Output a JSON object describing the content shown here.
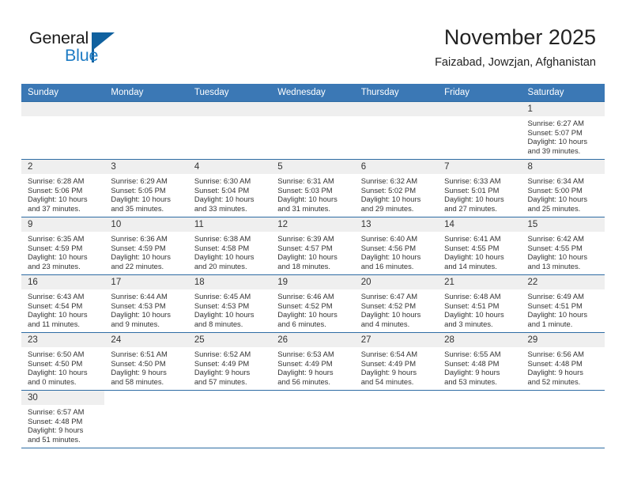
{
  "logo": {
    "word1": "General",
    "word2": "Blue",
    "accent": "#10619f",
    "blue_text": "#1f7cc4"
  },
  "header": {
    "title": "November 2025",
    "subtitle": "Faizabad, Jowzjan, Afghanistan",
    "header_bg": "#3b78b5"
  },
  "weekdays": [
    "Sunday",
    "Monday",
    "Tuesday",
    "Wednesday",
    "Thursday",
    "Friday",
    "Saturday"
  ],
  "weeks": [
    [
      {
        "day": "",
        "empty": true
      },
      {
        "day": "",
        "empty": true
      },
      {
        "day": "",
        "empty": true
      },
      {
        "day": "",
        "empty": true
      },
      {
        "day": "",
        "empty": true
      },
      {
        "day": "",
        "empty": true
      },
      {
        "day": "1",
        "sunrise": "Sunrise: 6:27 AM",
        "sunset": "Sunset: 5:07 PM",
        "daylight1": "Daylight: 10 hours",
        "daylight2": "and 39 minutes."
      }
    ],
    [
      {
        "day": "2",
        "sunrise": "Sunrise: 6:28 AM",
        "sunset": "Sunset: 5:06 PM",
        "daylight1": "Daylight: 10 hours",
        "daylight2": "and 37 minutes."
      },
      {
        "day": "3",
        "sunrise": "Sunrise: 6:29 AM",
        "sunset": "Sunset: 5:05 PM",
        "daylight1": "Daylight: 10 hours",
        "daylight2": "and 35 minutes."
      },
      {
        "day": "4",
        "sunrise": "Sunrise: 6:30 AM",
        "sunset": "Sunset: 5:04 PM",
        "daylight1": "Daylight: 10 hours",
        "daylight2": "and 33 minutes."
      },
      {
        "day": "5",
        "sunrise": "Sunrise: 6:31 AM",
        "sunset": "Sunset: 5:03 PM",
        "daylight1": "Daylight: 10 hours",
        "daylight2": "and 31 minutes."
      },
      {
        "day": "6",
        "sunrise": "Sunrise: 6:32 AM",
        "sunset": "Sunset: 5:02 PM",
        "daylight1": "Daylight: 10 hours",
        "daylight2": "and 29 minutes."
      },
      {
        "day": "7",
        "sunrise": "Sunrise: 6:33 AM",
        "sunset": "Sunset: 5:01 PM",
        "daylight1": "Daylight: 10 hours",
        "daylight2": "and 27 minutes."
      },
      {
        "day": "8",
        "sunrise": "Sunrise: 6:34 AM",
        "sunset": "Sunset: 5:00 PM",
        "daylight1": "Daylight: 10 hours",
        "daylight2": "and 25 minutes."
      }
    ],
    [
      {
        "day": "9",
        "sunrise": "Sunrise: 6:35 AM",
        "sunset": "Sunset: 4:59 PM",
        "daylight1": "Daylight: 10 hours",
        "daylight2": "and 23 minutes."
      },
      {
        "day": "10",
        "sunrise": "Sunrise: 6:36 AM",
        "sunset": "Sunset: 4:59 PM",
        "daylight1": "Daylight: 10 hours",
        "daylight2": "and 22 minutes."
      },
      {
        "day": "11",
        "sunrise": "Sunrise: 6:38 AM",
        "sunset": "Sunset: 4:58 PM",
        "daylight1": "Daylight: 10 hours",
        "daylight2": "and 20 minutes."
      },
      {
        "day": "12",
        "sunrise": "Sunrise: 6:39 AM",
        "sunset": "Sunset: 4:57 PM",
        "daylight1": "Daylight: 10 hours",
        "daylight2": "and 18 minutes."
      },
      {
        "day": "13",
        "sunrise": "Sunrise: 6:40 AM",
        "sunset": "Sunset: 4:56 PM",
        "daylight1": "Daylight: 10 hours",
        "daylight2": "and 16 minutes."
      },
      {
        "day": "14",
        "sunrise": "Sunrise: 6:41 AM",
        "sunset": "Sunset: 4:55 PM",
        "daylight1": "Daylight: 10 hours",
        "daylight2": "and 14 minutes."
      },
      {
        "day": "15",
        "sunrise": "Sunrise: 6:42 AM",
        "sunset": "Sunset: 4:55 PM",
        "daylight1": "Daylight: 10 hours",
        "daylight2": "and 13 minutes."
      }
    ],
    [
      {
        "day": "16",
        "sunrise": "Sunrise: 6:43 AM",
        "sunset": "Sunset: 4:54 PM",
        "daylight1": "Daylight: 10 hours",
        "daylight2": "and 11 minutes."
      },
      {
        "day": "17",
        "sunrise": "Sunrise: 6:44 AM",
        "sunset": "Sunset: 4:53 PM",
        "daylight1": "Daylight: 10 hours",
        "daylight2": "and 9 minutes."
      },
      {
        "day": "18",
        "sunrise": "Sunrise: 6:45 AM",
        "sunset": "Sunset: 4:53 PM",
        "daylight1": "Daylight: 10 hours",
        "daylight2": "and 8 minutes."
      },
      {
        "day": "19",
        "sunrise": "Sunrise: 6:46 AM",
        "sunset": "Sunset: 4:52 PM",
        "daylight1": "Daylight: 10 hours",
        "daylight2": "and 6 minutes."
      },
      {
        "day": "20",
        "sunrise": "Sunrise: 6:47 AM",
        "sunset": "Sunset: 4:52 PM",
        "daylight1": "Daylight: 10 hours",
        "daylight2": "and 4 minutes."
      },
      {
        "day": "21",
        "sunrise": "Sunrise: 6:48 AM",
        "sunset": "Sunset: 4:51 PM",
        "daylight1": "Daylight: 10 hours",
        "daylight2": "and 3 minutes."
      },
      {
        "day": "22",
        "sunrise": "Sunrise: 6:49 AM",
        "sunset": "Sunset: 4:51 PM",
        "daylight1": "Daylight: 10 hours",
        "daylight2": "and 1 minute."
      }
    ],
    [
      {
        "day": "23",
        "sunrise": "Sunrise: 6:50 AM",
        "sunset": "Sunset: 4:50 PM",
        "daylight1": "Daylight: 10 hours",
        "daylight2": "and 0 minutes."
      },
      {
        "day": "24",
        "sunrise": "Sunrise: 6:51 AM",
        "sunset": "Sunset: 4:50 PM",
        "daylight1": "Daylight: 9 hours",
        "daylight2": "and 58 minutes."
      },
      {
        "day": "25",
        "sunrise": "Sunrise: 6:52 AM",
        "sunset": "Sunset: 4:49 PM",
        "daylight1": "Daylight: 9 hours",
        "daylight2": "and 57 minutes."
      },
      {
        "day": "26",
        "sunrise": "Sunrise: 6:53 AM",
        "sunset": "Sunset: 4:49 PM",
        "daylight1": "Daylight: 9 hours",
        "daylight2": "and 56 minutes."
      },
      {
        "day": "27",
        "sunrise": "Sunrise: 6:54 AM",
        "sunset": "Sunset: 4:49 PM",
        "daylight1": "Daylight: 9 hours",
        "daylight2": "and 54 minutes."
      },
      {
        "day": "28",
        "sunrise": "Sunrise: 6:55 AM",
        "sunset": "Sunset: 4:48 PM",
        "daylight1": "Daylight: 9 hours",
        "daylight2": "and 53 minutes."
      },
      {
        "day": "29",
        "sunrise": "Sunrise: 6:56 AM",
        "sunset": "Sunset: 4:48 PM",
        "daylight1": "Daylight: 9 hours",
        "daylight2": "and 52 minutes."
      }
    ],
    [
      {
        "day": "30",
        "sunrise": "Sunrise: 6:57 AM",
        "sunset": "Sunset: 4:48 PM",
        "daylight1": "Daylight: 9 hours",
        "daylight2": "and 51 minutes."
      },
      {
        "day": "",
        "blank": true
      },
      {
        "day": "",
        "blank": true
      },
      {
        "day": "",
        "blank": true
      },
      {
        "day": "",
        "blank": true
      },
      {
        "day": "",
        "blank": true
      },
      {
        "day": "",
        "blank": true
      }
    ]
  ]
}
